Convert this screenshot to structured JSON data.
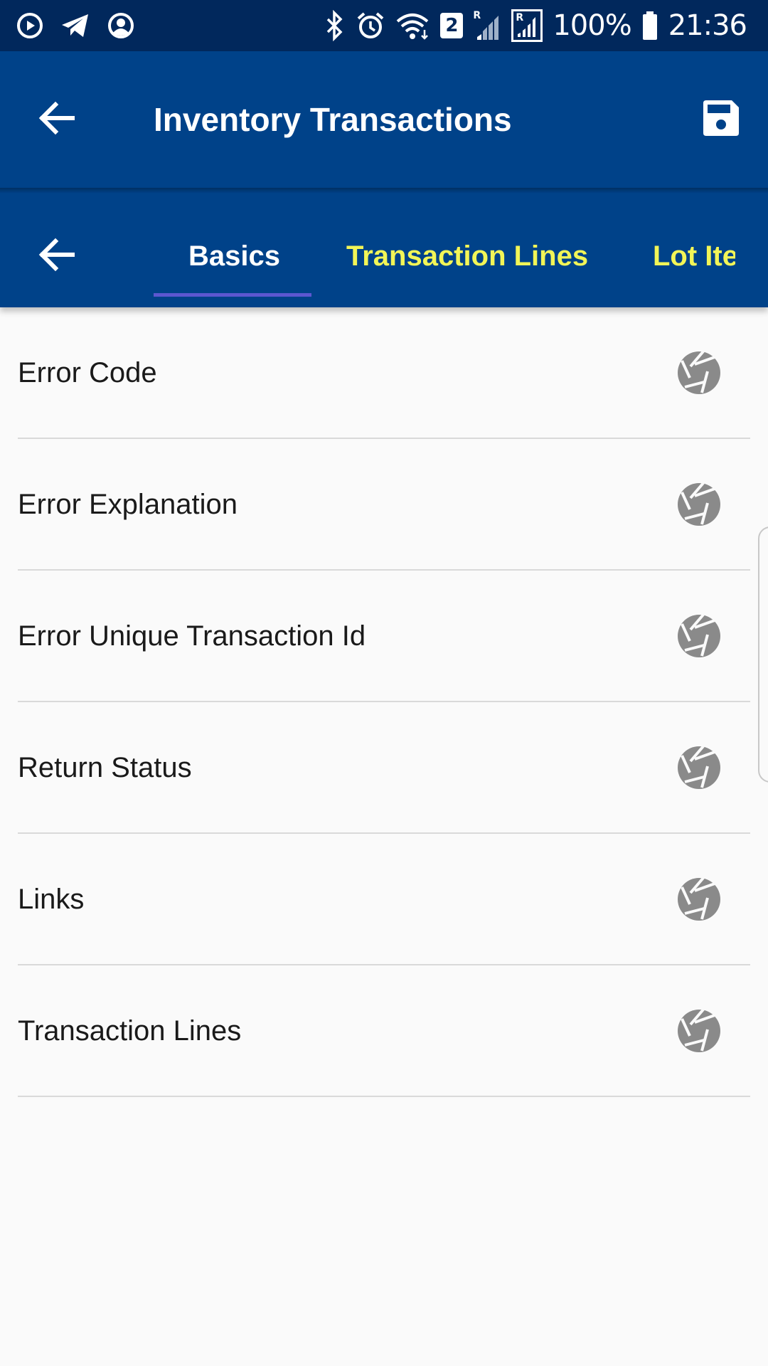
{
  "status_bar": {
    "battery": "100%",
    "time": "21:36",
    "sim_badge": "2",
    "roaming_1": "R",
    "roaming_2": "R",
    "left_icons": [
      "media-play-icon",
      "telegram-icon",
      "account-circle-icon"
    ],
    "right_icons": [
      "bluetooth-icon",
      "alarm-icon",
      "wifi-icon",
      "signal-icon",
      "battery-icon"
    ]
  },
  "app_bar": {
    "title": "Inventory Transactions",
    "back_icon": "arrow-left-icon",
    "save_icon": "floppy-disk-icon"
  },
  "tabs": {
    "back_icon": "arrow-left-icon",
    "items": [
      {
        "label": "Basics",
        "active": true
      },
      {
        "label": "Transaction Lines",
        "active": false
      },
      {
        "label": "Lot Ite",
        "active": false
      }
    ]
  },
  "list": {
    "items": [
      {
        "label": "Error Code",
        "icon": "camera-aperture-icon"
      },
      {
        "label": "Error Explanation",
        "icon": "camera-aperture-icon"
      },
      {
        "label": "Error Unique Transaction Id",
        "icon": "camera-aperture-icon"
      },
      {
        "label": "Return Status",
        "icon": "camera-aperture-icon"
      },
      {
        "label": "Links",
        "icon": "camera-aperture-icon"
      },
      {
        "label": "Transaction Lines",
        "icon": "camera-aperture-icon"
      }
    ]
  },
  "colors": {
    "status_bar": "#01285c",
    "primary": "#004289",
    "active_tab_text": "#ffffff",
    "inactive_tab_text": "#f2f557",
    "tab_indicator": "#5c57d0",
    "background": "#fafafa",
    "icon_gray": "#8a8a8a",
    "divider": "#d9d9d9"
  }
}
